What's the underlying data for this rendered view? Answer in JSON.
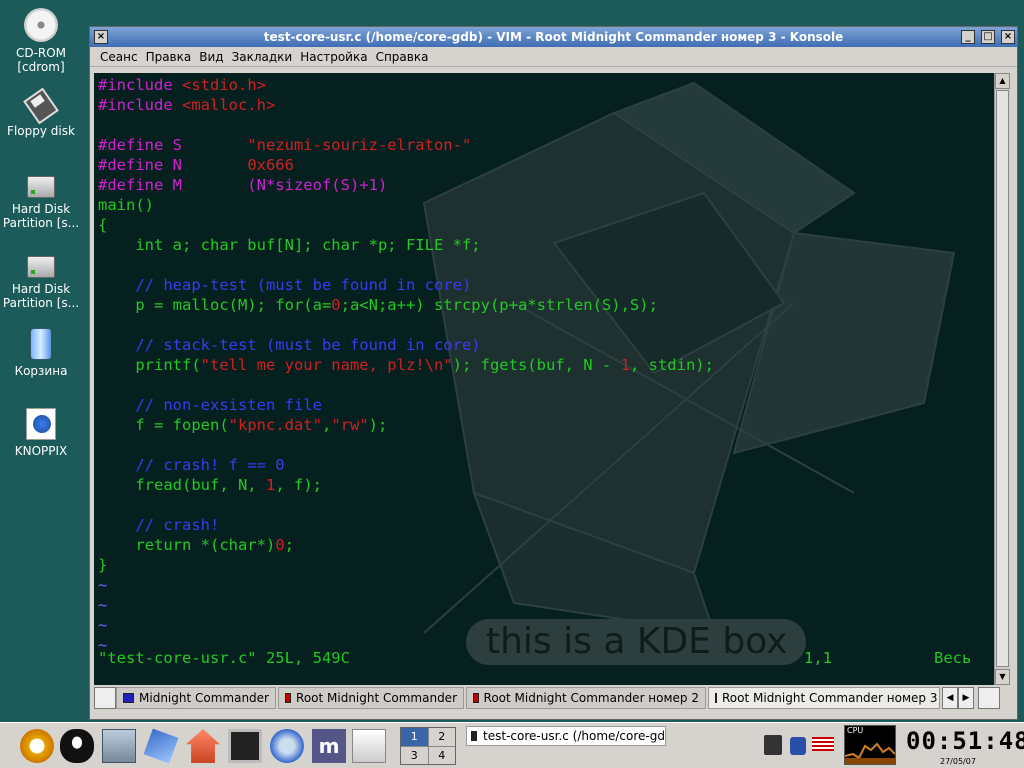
{
  "desktop": {
    "icons": [
      {
        "label": "CD-ROM\n[cdrom]"
      },
      {
        "label": "Floppy disk"
      },
      {
        "label": "Hard Disk\nPartition [s..."
      },
      {
        "label": "Hard Disk\nPartition [s..."
      },
      {
        "label": "Корзина"
      },
      {
        "label": "KNOPPIX"
      }
    ]
  },
  "window": {
    "title": "test-core-usr.c (/home/core-gdb) - VIM - Root Midnight Commander номер 3 - Konsole",
    "menu": [
      "Сеанс",
      "Правка",
      "Вид",
      "Закладки",
      "Настройка",
      "Справка"
    ],
    "status_file": "\"test-core-usr.c\" 25L, 549C",
    "status_pos": "1,1",
    "status_all": "Весь",
    "background_caption": "this is a KDE box",
    "tabs": [
      {
        "label": "Midnight Commander",
        "color": "#2020c0"
      },
      {
        "label": "Root Midnight Commander",
        "color": "#c00000"
      },
      {
        "label": "Root Midnight Commander номер 2",
        "color": "#c00000"
      },
      {
        "label": "Root Midnight Commander номер 3",
        "color": "#c00000"
      }
    ]
  },
  "taskbar": {
    "pager": [
      "1",
      "2",
      "3",
      "4"
    ],
    "current_desktop": "1",
    "task_label": "test-core-usr.c (/home/core-gd",
    "cpu_label": "CPU",
    "clock": "00:51:48",
    "date": "27/05/07"
  }
}
